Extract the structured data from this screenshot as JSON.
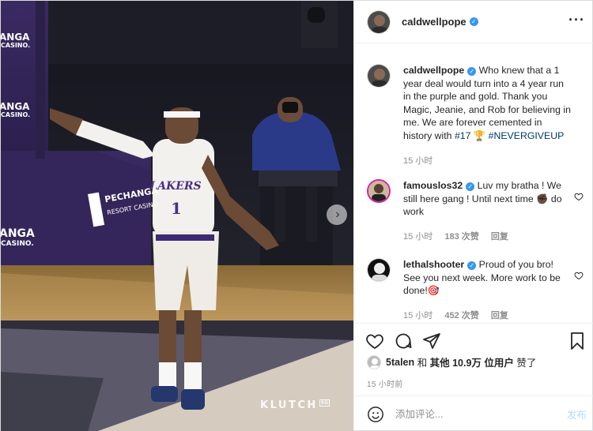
{
  "photo": {
    "watermark_text": "KLUTCH",
    "watermark_tag": "SG",
    "banner_texts": [
      "ANGA",
      "CASINO.",
      "ANGA",
      "CASINO.",
      "ANGA",
      "CASINO."
    ],
    "pechanga_text": "PECHANGA",
    "resort_text": "RESORT CASINO",
    "jersey_team": "LAKERS",
    "jersey_number": "1",
    "next_icon": "chevron-right-icon"
  },
  "header": {
    "username": "caldwellpope",
    "more_icon": "more-horizontal-icon"
  },
  "caption": {
    "username": "caldwellpope",
    "text": "Who knew that a 1 year deal would turn into a 4 year run in the purple and gold. Thank you Magic, Jeanie, and Rob for believing in me. We are forever cemented in history with",
    "tag1": "#17",
    "trophy": "🏆",
    "tag2": "#NEVERGIVEUP",
    "time": "15 小时"
  },
  "comments": [
    {
      "username": "famouslos32",
      "text": "Luv my bratha ! We still here gang ! Until next time ✊🏿 do work",
      "time": "15 小时",
      "likes": "183 次赞",
      "reply": "回复"
    },
    {
      "username": "lethalshooter",
      "text": "Proud of you bro! See you next week. More work to be done!🎯",
      "time": "15 小时",
      "likes": "452 次赞",
      "reply": "回复"
    }
  ],
  "actions": {
    "like_icon": "heart-icon",
    "comment_icon": "comment-icon",
    "share_icon": "paper-plane-icon",
    "save_icon": "bookmark-icon"
  },
  "likes": {
    "user": "5talen",
    "and": "和",
    "others": "其他 10.9万 位用户",
    "liked": "赞了"
  },
  "post_time": "15 小时前",
  "add_comment": {
    "placeholder": "添加评论...",
    "post_label": "发布",
    "emoji_icon": "smile-icon"
  },
  "colors": {
    "accent": "#3897f0",
    "link": "#00376b",
    "muted": "#8e8e8e",
    "post_disabled": "#b3dbff"
  }
}
